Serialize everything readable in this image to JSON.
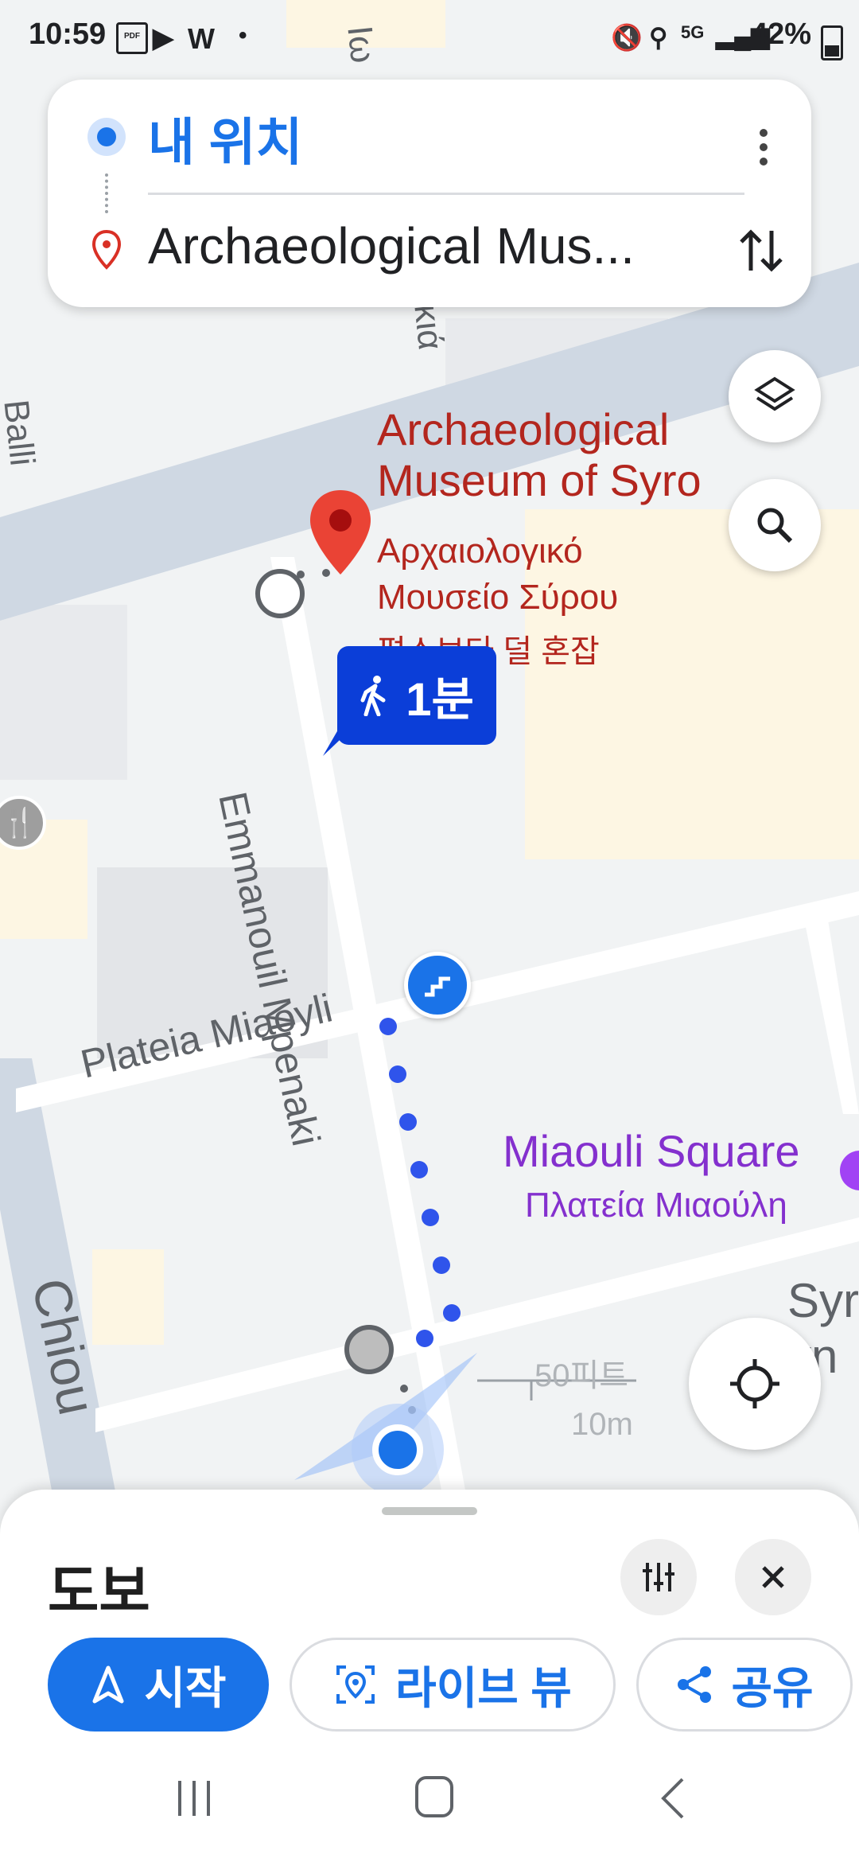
{
  "status_bar": {
    "time": "10:59",
    "battery": "42%"
  },
  "route": {
    "origin": "내 위치",
    "destination": "Archaeological Mus..."
  },
  "map": {
    "poi_name_en_line1": "Archaeological",
    "poi_name_en_line2": "Museum of Syro",
    "poi_name_gr_line1": "Αρχαιολογικό",
    "poi_name_gr_line2": "Μουσείο Σύρου",
    "poi_status": "평소보다 덜 혼잡",
    "walk_time": "1분",
    "street_emmanouil": "Emmanouil Mpenaki",
    "street_plateia": "Plateia Miaoyli",
    "street_chiou": "Chiou",
    "street_top": "Ιω",
    "street_top2": "κιά",
    "street_left": "Balli",
    "square_en": "Miaouli Square",
    "square_gr": "Πλατεία Μιαούλη",
    "place_syr_line1": "Syr",
    "place_syr_line2": "vn",
    "scale_feet": "50피트",
    "scale_meters": "10m"
  },
  "bottom_sheet": {
    "mode": "도보",
    "start_label": "시작",
    "liveview_label": "라이브 뷰",
    "share_label": "공유"
  },
  "colors": {
    "accent": "#1a73e8",
    "route_dot": "#2f54eb",
    "poi_red": "#b3261e",
    "square_purple": "#8430ce",
    "chip_blue": "#0b3ed8"
  }
}
